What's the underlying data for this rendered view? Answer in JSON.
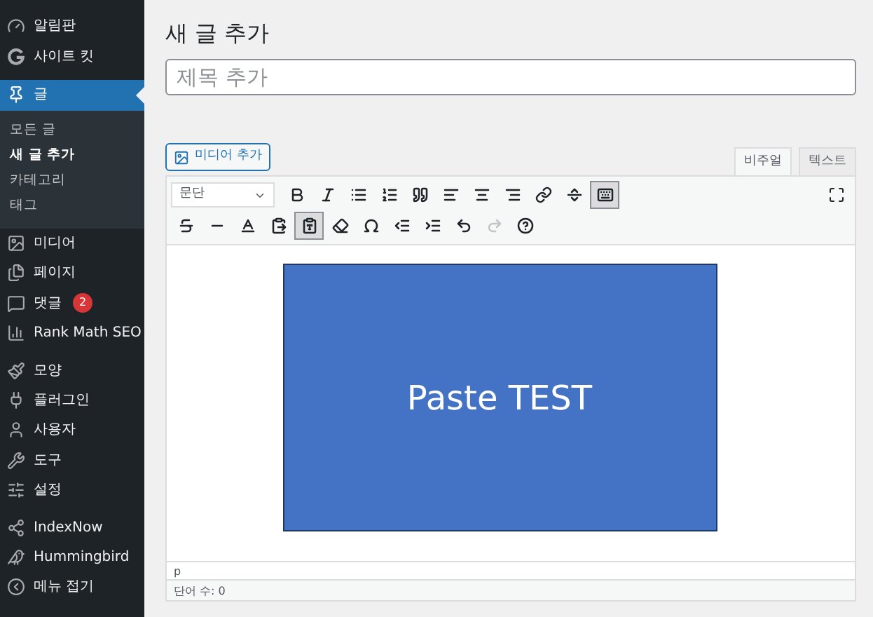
{
  "sidebar": {
    "items": [
      {
        "kind": "dashboard",
        "label": "알림판",
        "selected": false
      },
      {
        "kind": "sitekit",
        "label": "사이트 킷",
        "selected": false
      },
      {
        "kind": "posts",
        "label": "글",
        "selected": true,
        "children": [
          {
            "label": "모든 글",
            "selected": false
          },
          {
            "label": "새 글 추가",
            "selected": true
          },
          {
            "label": "카테고리",
            "selected": false
          },
          {
            "label": "태그",
            "selected": false
          }
        ]
      },
      {
        "kind": "media",
        "label": "미디어",
        "selected": false
      },
      {
        "kind": "pages",
        "label": "페이지",
        "selected": false
      },
      {
        "kind": "comments",
        "label": "댓글",
        "selected": false,
        "badge": "2"
      },
      {
        "kind": "rankmath",
        "label": "Rank Math SEO",
        "selected": false
      },
      {
        "kind": "appearance",
        "label": "모양",
        "selected": false,
        "gap": true
      },
      {
        "kind": "plugins",
        "label": "플러그인",
        "selected": false
      },
      {
        "kind": "users",
        "label": "사용자",
        "selected": false
      },
      {
        "kind": "tools",
        "label": "도구",
        "selected": false
      },
      {
        "kind": "settings",
        "label": "설정",
        "selected": false
      },
      {
        "kind": "indexnow",
        "label": "IndexNow",
        "selected": false,
        "gap": true
      },
      {
        "kind": "hummingbird",
        "label": "Hummingbird",
        "selected": false
      },
      {
        "kind": "collapse",
        "label": "메뉴 접기",
        "selected": false
      }
    ]
  },
  "page_title": "새 글 추가",
  "title_field": {
    "placeholder": "제목 추가"
  },
  "media_button": "미디어 추가",
  "editor_tabs": [
    {
      "label": "비주얼",
      "selected": true
    },
    {
      "label": "텍스트",
      "selected": false
    }
  ],
  "format_select": {
    "value": "문단"
  },
  "toolbar_rows": [
    [
      {
        "kind": "bold",
        "active": false,
        "disabled": false
      },
      {
        "kind": "italic",
        "active": false,
        "disabled": false
      },
      {
        "kind": "bullets",
        "active": false,
        "disabled": false
      },
      {
        "kind": "numbers",
        "active": false,
        "disabled": false
      },
      {
        "kind": "quote",
        "active": false,
        "disabled": false
      },
      {
        "kind": "align-left",
        "active": false,
        "disabled": false
      },
      {
        "kind": "align-center",
        "active": false,
        "disabled": false
      },
      {
        "kind": "align-right",
        "active": false,
        "disabled": false
      },
      {
        "kind": "link",
        "active": false,
        "disabled": false
      },
      {
        "kind": "more",
        "active": false,
        "disabled": false
      },
      {
        "kind": "toolbar-toggle",
        "active": true,
        "disabled": false
      }
    ],
    [
      {
        "kind": "strike",
        "active": false,
        "disabled": false
      },
      {
        "kind": "hr",
        "active": false,
        "disabled": false
      },
      {
        "kind": "text-color",
        "active": false,
        "disabled": false
      },
      {
        "kind": "paste",
        "active": false,
        "disabled": false
      },
      {
        "kind": "paste-text",
        "active": true,
        "disabled": false
      },
      {
        "kind": "clear",
        "active": false,
        "disabled": false
      },
      {
        "kind": "omega",
        "active": false,
        "disabled": false
      },
      {
        "kind": "outdent",
        "active": false,
        "disabled": false
      },
      {
        "kind": "indent",
        "active": false,
        "disabled": false
      },
      {
        "kind": "undo",
        "active": false,
        "disabled": false
      },
      {
        "kind": "redo",
        "active": false,
        "disabled": true
      },
      {
        "kind": "help",
        "active": false,
        "disabled": false
      }
    ]
  ],
  "content": {
    "slide_text": "Paste TEST"
  },
  "path": "p",
  "word_count": "단어 수: 0"
}
